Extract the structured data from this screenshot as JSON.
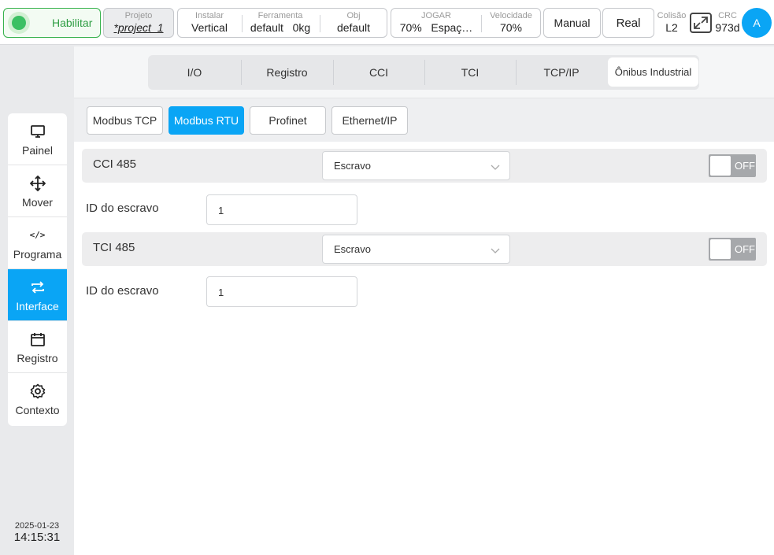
{
  "topbar": {
    "enable_label": "Habilitar",
    "project": {
      "caption": "Projeto",
      "value": "*project_1"
    },
    "install": {
      "caption": "Instalar",
      "value": "Vertical"
    },
    "tool": {
      "caption": "Ferramenta",
      "name": "default",
      "weight": "0kg"
    },
    "obj": {
      "caption": "Obj",
      "value": "default"
    },
    "jog": {
      "caption": "JOGAR",
      "value": "70%",
      "space": "Espaç…"
    },
    "speed": {
      "caption": "Velocidade",
      "value": "70%"
    },
    "mode_manual": "Manual",
    "mode_real": "Real",
    "collision": {
      "caption": "Colisão",
      "value": "L2"
    },
    "crc": {
      "caption": "CRC",
      "value": "973d"
    },
    "avatar": "A"
  },
  "sidebar": {
    "items": [
      {
        "label": "Painel",
        "icon": "monitor-icon"
      },
      {
        "label": "Mover",
        "icon": "move-icon"
      },
      {
        "label": "Programa",
        "icon": "code-icon"
      },
      {
        "label": "Interface",
        "icon": "swap-icon",
        "active": true
      },
      {
        "label": "Registro",
        "icon": "calendar-icon"
      },
      {
        "label": "Contexto",
        "icon": "gear-icon"
      }
    ],
    "date": "2025-01-23",
    "time": "14:15:31"
  },
  "tabs": [
    "I/O",
    "Registro",
    "CCI",
    "TCI",
    "TCP/IP",
    "Ônibus Industrial"
  ],
  "active_tab": "Ônibus Industrial",
  "subtabs": [
    "Modbus TCP",
    "Modbus RTU",
    "Profinet",
    "Ethernet/IP"
  ],
  "active_subtab": "Modbus RTU",
  "sections": [
    {
      "title": "CCI 485",
      "mode": "Escravo",
      "switch": "OFF",
      "id_label": "ID do escravo",
      "id_value": "1"
    },
    {
      "title": "TCI 485",
      "mode": "Escravo",
      "switch": "OFF",
      "id_label": "ID do escravo",
      "id_value": "1"
    }
  ],
  "colors": {
    "accent": "#0aa5f5",
    "enable_green": "#3cc063",
    "switch_off": "#a6a8ab"
  }
}
